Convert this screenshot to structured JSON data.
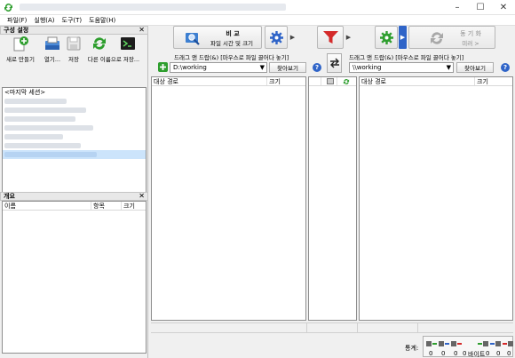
{
  "menu": [
    "파일(F)",
    "실행(A)",
    "도구(T)",
    "도움말(H)"
  ],
  "left_panel": {
    "config_header": "구성 설정",
    "buttons": [
      {
        "label": "새로 만들기",
        "icon": "new-icon"
      },
      {
        "label": "열기...",
        "icon": "open-icon"
      },
      {
        "label": "저장",
        "icon": "save-icon"
      },
      {
        "label": "다른 이름으로 저장...",
        "icon": "save-as-icon"
      }
    ],
    "sessions": [
      "<마지막 세션>"
    ],
    "details_header": "개요",
    "details_columns": [
      "이름",
      "항목",
      "크기"
    ]
  },
  "toolbar": {
    "compare_title": "비 교",
    "compare_sub": "파일 시간 및 크기",
    "sync_title": "동 기 화",
    "sync_sub": "미러 >"
  },
  "left_side": {
    "drag_hint": "드래그 앤 드랍(&) [마우스로 파일 끌어다 놓기]",
    "path": "D:\\working",
    "browse": "찾아보기",
    "columns": [
      "대상 경로",
      "크기"
    ]
  },
  "right_side": {
    "drag_hint": "드래그 앤 드랍(&) [마우스로 파일 끌어다 놓기]",
    "path": "\\\\working",
    "browse": "찾아보기",
    "columns": [
      "대상 경로",
      "크기"
    ]
  },
  "stats": {
    "label": "통계:",
    "bytes_label": "바이트",
    "values": [
      "0",
      "0",
      "0",
      "0",
      "0",
      "0",
      "0"
    ]
  },
  "colors": {
    "accent_blue": "#2f64c8",
    "green": "#2e9e2e",
    "red_filter": "#d42a2a",
    "selection": "#cce4fb"
  }
}
